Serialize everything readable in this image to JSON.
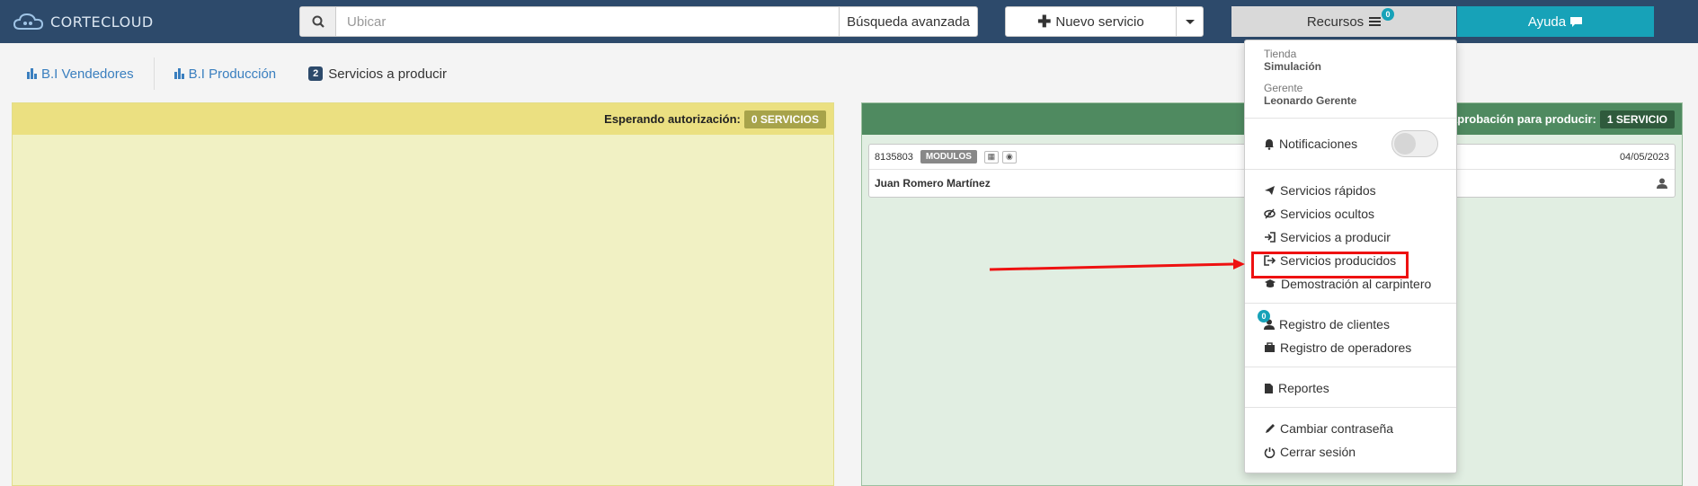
{
  "brand": {
    "name": "CORTECLOUD"
  },
  "search": {
    "placeholder": "Ubicar",
    "advanced_label": "Búsqueda avanzada"
  },
  "toolbar": {
    "new_service_label": "Nuevo servicio",
    "resources_label": "Recursos",
    "resources_badge": "0",
    "help_label": "Ayuda"
  },
  "subnav": {
    "bi_sellers": "B.I Vendedores",
    "bi_production": "B.I Producción",
    "to_produce_count": "2",
    "to_produce_label": "Servicios a producir"
  },
  "panel_left": {
    "title": "Esperando autorización:",
    "count": "0 SERVICIOS"
  },
  "panel_right": {
    "title": "o aprobación para producir:",
    "count": "1 SERVICIO"
  },
  "card": {
    "code": "8135803",
    "tag": "MODULOS",
    "date": "04/05/2023",
    "client": "Juan Romero Martínez"
  },
  "dropdown": {
    "store_label": "Tienda",
    "store_value": "Simulación",
    "manager_label": "Gerente",
    "manager_value": "Leonardo Gerente",
    "notifications": "Notificaciones",
    "quick_services": "Servicios rápidos",
    "hidden_services": "Servicios ocultos",
    "to_produce": "Servicios a producir",
    "produced": "Servicios producidos",
    "demo": "Demostración al carpintero",
    "clients_badge": "0",
    "clients": "Registro de clientes",
    "operators": "Registro de operadores",
    "reports": "Reportes",
    "change_password": "Cambiar contraseña",
    "logout": "Cerrar sesión"
  },
  "colors": {
    "navbar": "#2d4a6b",
    "accent": "#17a2b8",
    "highlight": "#ee1111",
    "yellow_panel": "#f1f1c4",
    "green_panel": "#e1eee2"
  }
}
